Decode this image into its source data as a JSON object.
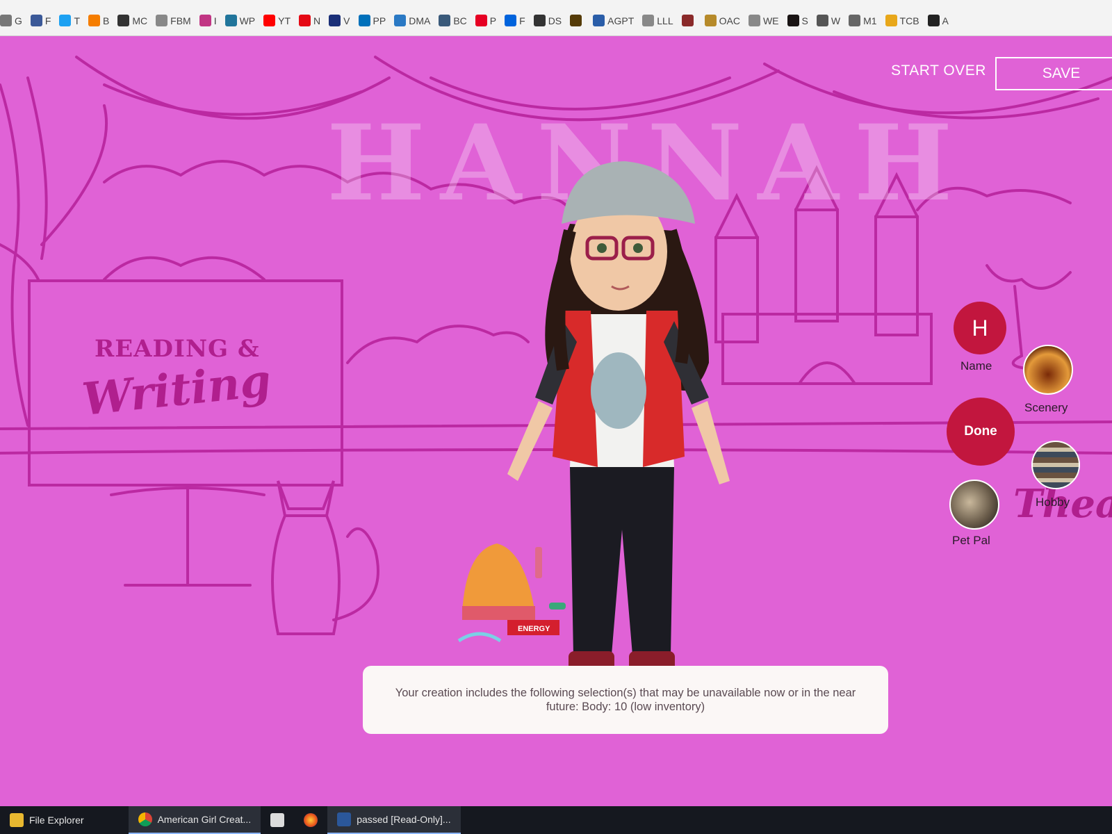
{
  "bookmarks": [
    {
      "label": "G",
      "icon": "page-icon",
      "color": "#777777"
    },
    {
      "label": "F",
      "icon": "facebook-icon",
      "color": "#3b5998"
    },
    {
      "label": "T",
      "icon": "twitter-icon",
      "color": "#1da1f2"
    },
    {
      "label": "B",
      "icon": "blogger-icon",
      "color": "#f57d00"
    },
    {
      "label": "MC",
      "icon": "mailchimp-icon",
      "color": "#333333"
    },
    {
      "label": "FBM",
      "icon": "page-icon",
      "color": "#888888"
    },
    {
      "label": "I",
      "icon": "instagram-icon",
      "color": "#c13584"
    },
    {
      "label": "WP",
      "icon": "wordpress-icon",
      "color": "#21759b"
    },
    {
      "label": "YT",
      "icon": "youtube-icon",
      "color": "#ff0000"
    },
    {
      "label": "N",
      "icon": "netflix-icon",
      "color": "#e50914"
    },
    {
      "label": "V",
      "icon": "vimeo-icon",
      "color": "#1a2f78"
    },
    {
      "label": "PP",
      "icon": "paypal-icon",
      "color": "#0070ba"
    },
    {
      "label": "DMA",
      "icon": "dma-icon",
      "color": "#2a79c4"
    },
    {
      "label": "BC",
      "icon": "bc-icon",
      "color": "#3a5a7a"
    },
    {
      "label": "P",
      "icon": "pinterest-icon",
      "color": "#e60023"
    },
    {
      "label": "F",
      "icon": "flickr-icon",
      "color": "#0063dc"
    },
    {
      "label": "DS",
      "icon": "ds-icon",
      "color": "#333333"
    },
    {
      "label": "",
      "icon": "goodreads-icon",
      "color": "#553b08"
    },
    {
      "label": "AGPT",
      "icon": "agpt-icon",
      "color": "#2a5da8"
    },
    {
      "label": "LLL",
      "icon": "page-icon",
      "color": "#888888"
    },
    {
      "label": "",
      "icon": "lib-icon",
      "color": "#8a2a2a"
    },
    {
      "label": "OAC",
      "icon": "oac-icon",
      "color": "#b68a2a"
    },
    {
      "label": "WE",
      "icon": "page-icon",
      "color": "#888888"
    },
    {
      "label": "S",
      "icon": "spotify-icon",
      "color": "#191414"
    },
    {
      "label": "W",
      "icon": "wikipedia-icon",
      "color": "#555555"
    },
    {
      "label": "M1",
      "icon": "m1-icon",
      "color": "#666666"
    },
    {
      "label": "TCB",
      "icon": "tcb-icon",
      "color": "#e8a71a"
    },
    {
      "label": "A",
      "icon": "amazon-icon",
      "color": "#222222"
    }
  ],
  "header": {
    "start_over": "START OVER",
    "save": "SAVE"
  },
  "doll_name": "HANNAH",
  "scenery": {
    "sign_title": "READING &",
    "sign_subtitle": "Writing",
    "theater_word": "Theat"
  },
  "menu": {
    "name_initial": "H",
    "name_label": "Name",
    "scenery_label": "Scenery",
    "done_label": "Done",
    "hobby_label": "Hobby",
    "pet_label": "Pet Pal"
  },
  "notice": "Your creation includes the following selection(s) that may be unavailable now or in the near future: Body: 10 (low inventory)",
  "accessory_label": "ENERGY",
  "taskbar": {
    "file_explorer": "File Explorer",
    "chrome_tab": "American Girl Creat...",
    "word_doc": "passed [Read-Only]..."
  },
  "colors": {
    "background": "#e062d6",
    "line_art": "#b01f8e",
    "accent_red": "#c2163e"
  }
}
